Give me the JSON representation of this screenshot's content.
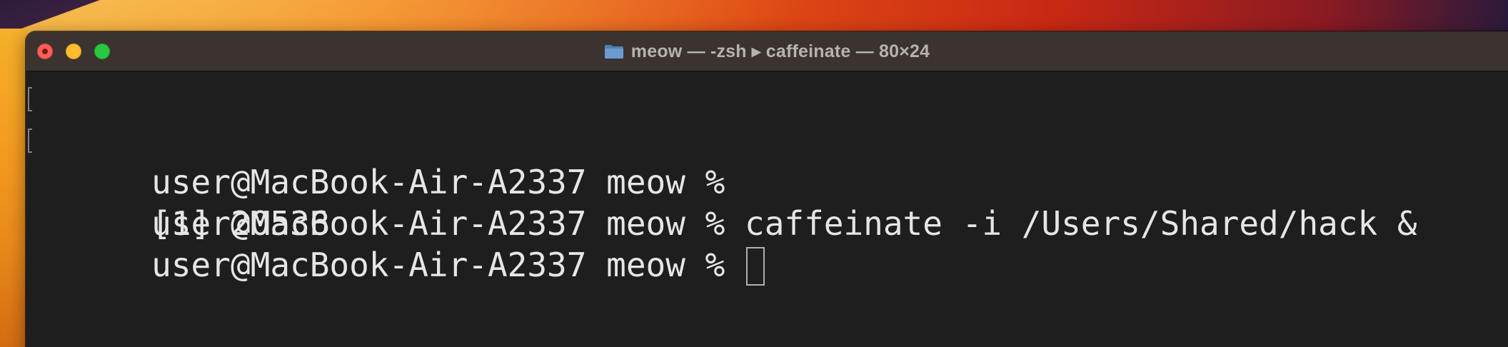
{
  "window": {
    "title": "meow — -zsh ▸ caffeinate — 80×24",
    "folder_icon": "folder-icon",
    "controls": [
      "close-button",
      "minimize-button",
      "zoom-button"
    ]
  },
  "terminal": {
    "lines": [
      {
        "text": "user@MacBook-Air-A2337 meow %",
        "marked": true
      },
      {
        "text": "user@MacBook-Air-A2337 meow % caffeinate -i /Users/Shared/hack &",
        "marked": true
      },
      {
        "text": "[1] 20536",
        "marked": false
      },
      {
        "text": "user@MacBook-Air-A2337 meow % ",
        "marked": false
      }
    ],
    "cursor_style": "block-outline"
  },
  "colors": {
    "terminal_bg": "#1e1e1e",
    "terminal_fg": "#e6e6e6",
    "titlebar_bg": "#3a3330",
    "title_fg": "#b8b2ae",
    "close": "#ff5f57",
    "minimize": "#febc2e",
    "zoom": "#28c840",
    "folder": "#6a9ccf"
  }
}
